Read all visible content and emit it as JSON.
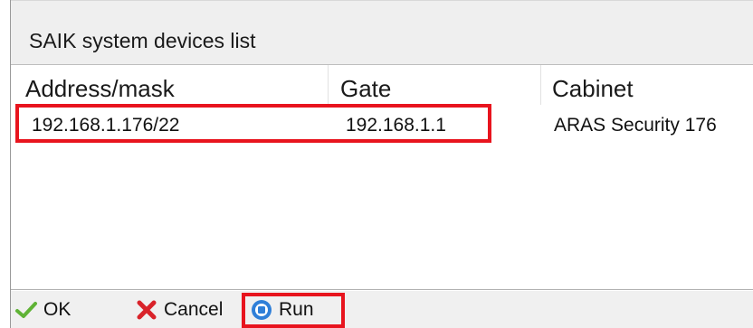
{
  "window": {
    "title": "SAIK system devices list"
  },
  "table": {
    "columns": [
      "Address/mask",
      "Gate",
      "Cabinet"
    ],
    "rows": [
      {
        "address_mask": "192.168.1.176/22",
        "gate": "192.168.1.1",
        "cabinet": "ARAS Security 176"
      }
    ]
  },
  "buttons": {
    "ok_label": "OK",
    "cancel_label": "Cancel",
    "run_label": "Run"
  },
  "icons": {
    "ok": "checkmark-icon",
    "cancel": "x-icon",
    "run": "run-icon"
  },
  "colors": {
    "highlight": "#e8141e",
    "ok_icon": "#5fb336",
    "cancel_icon": "#d9232a",
    "run_icon": "#2f7fd8"
  }
}
